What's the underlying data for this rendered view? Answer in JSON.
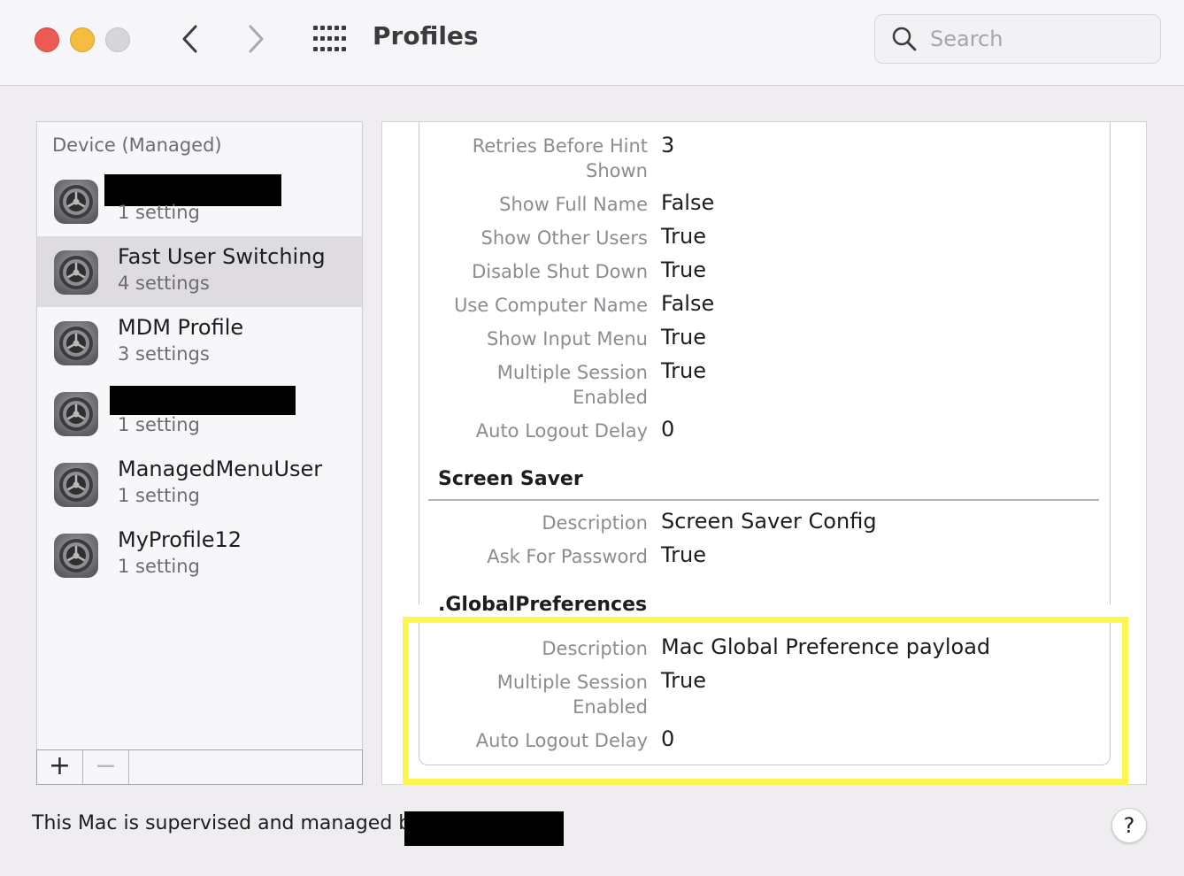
{
  "window": {
    "title": "Profiles",
    "search_placeholder": "Search"
  },
  "sidebar": {
    "header": "Device (Managed)",
    "items": [
      {
        "name": "",
        "count": "1 setting",
        "name_redacted": true
      },
      {
        "name": "Fast User Switching",
        "count": "4 settings",
        "selected": true
      },
      {
        "name": "MDM Profile",
        "count": "3 settings"
      },
      {
        "name": "",
        "count": "1 setting",
        "name_redacted": true
      },
      {
        "name": "ManagedMenuUser",
        "count": "1 setting"
      },
      {
        "name": "MyProfile12",
        "count": "1 setting"
      }
    ],
    "add_label": "+",
    "remove_label": "−"
  },
  "detail": {
    "login_window": [
      {
        "label": "Retries Before Hint Shown",
        "value": "3"
      },
      {
        "label": "Show Full Name",
        "value": "False"
      },
      {
        "label": "Show Other Users",
        "value": "True"
      },
      {
        "label": "Disable Shut Down",
        "value": "True"
      },
      {
        "label": "Use Computer Name",
        "value": "False"
      },
      {
        "label": "Show Input Menu",
        "value": "True"
      },
      {
        "label": "Multiple Session Enabled",
        "value": "True"
      },
      {
        "label": "Auto Logout Delay",
        "value": "0"
      }
    ],
    "screen_saver": {
      "title": "Screen Saver",
      "rows": [
        {
          "label": "Description",
          "value": "Screen Saver Config"
        },
        {
          "label": "Ask For Password",
          "value": "True"
        }
      ]
    },
    "global_preferences": {
      "title": ".GlobalPreferences",
      "rows": [
        {
          "label": "Description",
          "value": "Mac Global Preference payload"
        },
        {
          "label": "Multiple Session Enabled",
          "value": "True"
        },
        {
          "label": "Auto Logout Delay",
          "value": "0"
        }
      ]
    }
  },
  "footer": {
    "text": "This Mac is supervised and managed by",
    "help_label": "?"
  },
  "colors": {
    "highlight": "#fdf650",
    "close": "#ed5a53",
    "minimize": "#f4bd3f",
    "zoom_disabled": "#d7d5d9"
  }
}
